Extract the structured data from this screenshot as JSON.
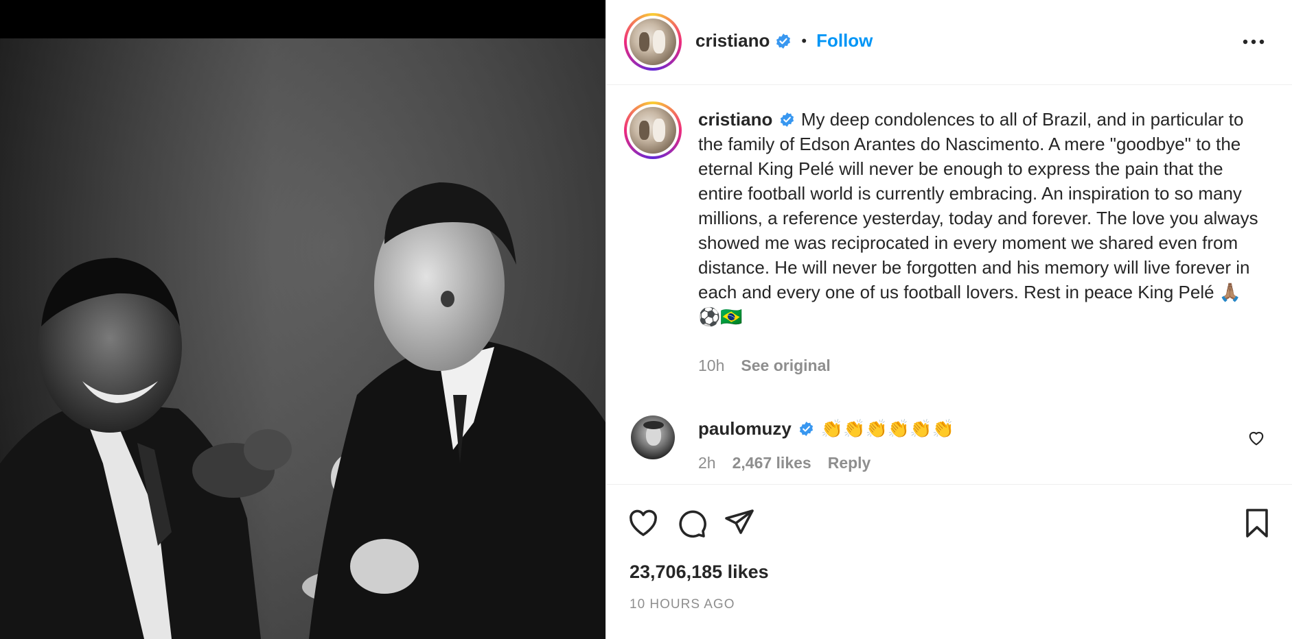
{
  "post": {
    "author": "cristiano",
    "follow_label": "Follow",
    "dot": "•"
  },
  "caption": {
    "username": "cristiano",
    "text": "My deep condolences to all of Brazil, and in particular to the family of Edson Arantes do Nascimento. A mere \"goodbye\" to the eternal King Pelé will never be enough to express the pain that the entire football world is currently embracing. An inspiration to so many millions, a reference yesterday, today and forever. The love you always showed me was reciprocated in every moment we shared even from distance. He will never be forgotten and his memory will live forever in each and every one of us football lovers. Rest in peace King Pelé 🙏🏽⚽🇧🇷",
    "time": "10h",
    "see_original": "See original"
  },
  "comment": {
    "username": "paulomuzy",
    "text": "👏👏👏👏👏👏",
    "time": "2h",
    "likes": "2,467 likes",
    "reply": "Reply"
  },
  "actions": {
    "likes": "23,706,185 likes",
    "timestamp": "10 HOURS AGO"
  },
  "colors": {
    "link_blue": "#0095f6",
    "verified_blue": "#3897f0",
    "muted": "#8e8e8e"
  },
  "icons": [
    "verified-badge-icon",
    "more-options-icon",
    "heart-icon",
    "comment-icon",
    "share-icon",
    "bookmark-icon"
  ]
}
